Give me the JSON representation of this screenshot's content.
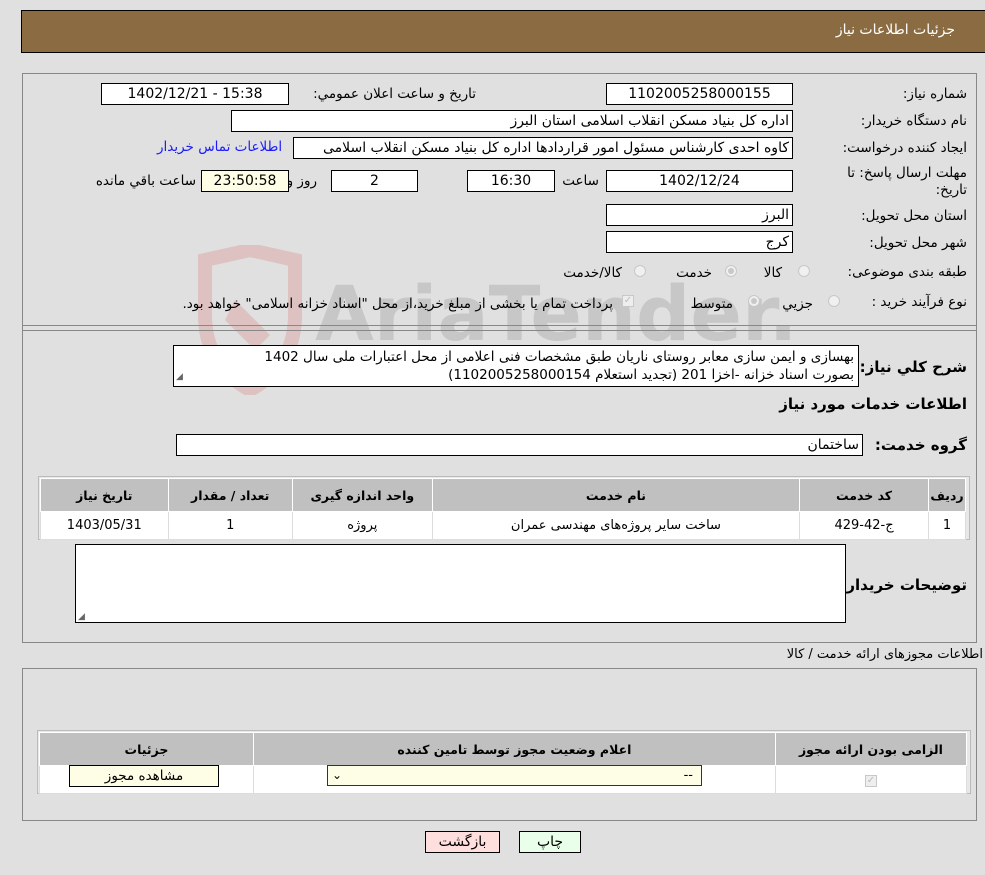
{
  "header": {
    "title": "جزئیات اطلاعات نیاز"
  },
  "form": {
    "need_number_label": "شماره نیاز:",
    "need_number": "1102005258000155",
    "announce_label": "تاریخ و ساعت اعلان عمومي:",
    "announce_value": "1402/12/21 - 15:38",
    "buyer_org_label": "نام دستگاه خریدار:",
    "buyer_org": "اداره کل بنیاد مسکن انقلاب اسلامی استان البرز",
    "creator_label": "ایجاد کننده درخواست:",
    "creator": "کاوه احدی کارشناس مسئول امور قراردادها اداره کل بنیاد مسکن انقلاب اسلامی",
    "contact_link": "اطلاعات تماس خریدار",
    "deadline_label_1": "مهلت ارسال پاسخ: تا",
    "deadline_label_2": "تاریخ:",
    "deadline_date": "1402/12/24",
    "time_label": "ساعت",
    "deadline_time": "16:30",
    "days_value": "2",
    "days_label": "روز و",
    "remaining_time": "23:50:58",
    "remaining_label": "ساعت باقي مانده",
    "province_label": "استان محل تحویل:",
    "province": "البرز",
    "city_label": "شهر محل تحویل:",
    "city": "کرج",
    "category_label": "طبقه بندی موضوعی:",
    "category_options": [
      {
        "label": "کالا",
        "selected": false
      },
      {
        "label": "خدمت",
        "selected": true
      },
      {
        "label": "کالا/خدمت",
        "selected": false
      }
    ],
    "process_label": "نوع فرآیند خرید :",
    "process_options": [
      {
        "label": "جزيي",
        "selected": false
      },
      {
        "label": "متوسط",
        "selected": true
      }
    ],
    "treasury_note": "پرداخت تمام یا بخشی از مبلغ خرید،از محل \"اسناد خزانه اسلامی\" خواهد بود.",
    "treasury_checked": true,
    "description_label": "شرح کلي نیاز:",
    "description_line1": "بهسازی و ایمن سازی معابر روستای ناریان طبق مشخصات فنی اعلامی از محل اعتبارات ملی سال 1402",
    "description_line2": "بصورت اسناد خزانه -اخزا 201 (تجدید استعلام 1102005258000154)",
    "services_title": "اطلاعات خدمات مورد نیاز",
    "service_group_label": "گروه خدمت:",
    "service_group": "ساختمان",
    "buyer_notes_label": "توضیحات خریدار:",
    "buyer_notes": ""
  },
  "services_table": {
    "headers": [
      "ردیف",
      "کد خدمت",
      "نام خدمت",
      "واحد اندازه گیری",
      "تعداد / مقدار",
      "تاریخ نیاز"
    ],
    "rows": [
      [
        "1",
        "ج-42-429",
        "ساخت سایر پروژه‌های مهندسی عمران",
        "پروژه",
        "1",
        "1403/05/31"
      ]
    ]
  },
  "permits": {
    "title": "اطلاعات مجوزهای ارائه خدمت / کالا",
    "headers": [
      "الزامی بودن ارائه مجوز",
      "اعلام وضعیت مجوز توسط تامین کننده",
      "جزئیات"
    ],
    "required_checked": true,
    "status_select": "--",
    "view_button": "مشاهده مجوز"
  },
  "footer": {
    "print_button": "چاپ",
    "back_button": "بازگشت"
  },
  "watermark": {
    "text": "AriaTender.neT"
  },
  "colors": {
    "header_bg": "#8b6c42",
    "back_button_bg": "#ffdede",
    "print_button_bg": "#eaffea",
    "link": "#1a1aff"
  }
}
